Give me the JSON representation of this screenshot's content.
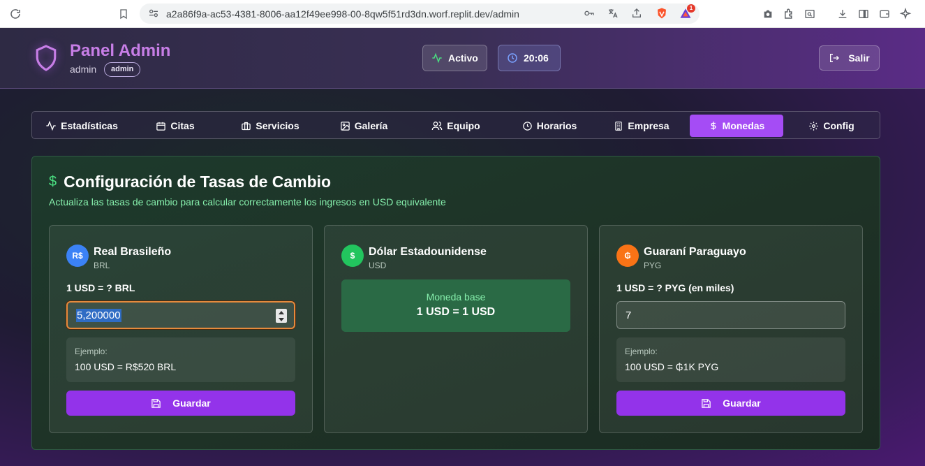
{
  "browser": {
    "url": "a2a86f9a-ac53-4381-8006-aa12f49ee998-00-8qw5f51rd3dn.worf.replit.dev/admin",
    "brave_badge": "1"
  },
  "header": {
    "title": "Panel Admin",
    "username": "admin",
    "role": "admin",
    "status": "Activo",
    "time": "20:06",
    "logout_label": "Salir"
  },
  "tabs": [
    {
      "label": "Estadísticas",
      "icon": "activity-icon"
    },
    {
      "label": "Citas",
      "icon": "calendar-icon"
    },
    {
      "label": "Servicios",
      "icon": "briefcase-icon"
    },
    {
      "label": "Galería",
      "icon": "image-icon"
    },
    {
      "label": "Equipo",
      "icon": "users-icon"
    },
    {
      "label": "Horarios",
      "icon": "clock-icon"
    },
    {
      "label": "Empresa",
      "icon": "building-icon"
    },
    {
      "label": "Monedas",
      "icon": "dollar-icon",
      "active": true
    },
    {
      "label": "Config",
      "icon": "gear-icon"
    }
  ],
  "section": {
    "title": "Configuración de Tasas de Cambio",
    "subtitle": "Actualiza las tasas de cambio para calcular correctamente los ingresos en USD equivalente"
  },
  "currencies": [
    {
      "symbol": "R$",
      "color": "#3b82f6",
      "name": "Real Brasileño",
      "code": "BRL",
      "rate_label": "1 USD = ? BRL",
      "value": "5,200000",
      "example_label": "Ejemplo:",
      "example": "100 USD = R$520 BRL",
      "save_label": "Guardar"
    },
    {
      "symbol": "$",
      "color": "#22c55e",
      "name": "Dólar Estadounidense",
      "code": "USD",
      "base_label": "Moneda base",
      "base_value": "1 USD = 1 USD"
    },
    {
      "symbol": "₲",
      "color": "#f97316",
      "name": "Guaraní Paraguayo",
      "code": "PYG",
      "rate_label": "1 USD = ? PYG (en miles)",
      "value": "7",
      "example_label": "Ejemplo:",
      "example": "100 USD = ₲1K PYG",
      "save_label": "Guardar"
    }
  ]
}
